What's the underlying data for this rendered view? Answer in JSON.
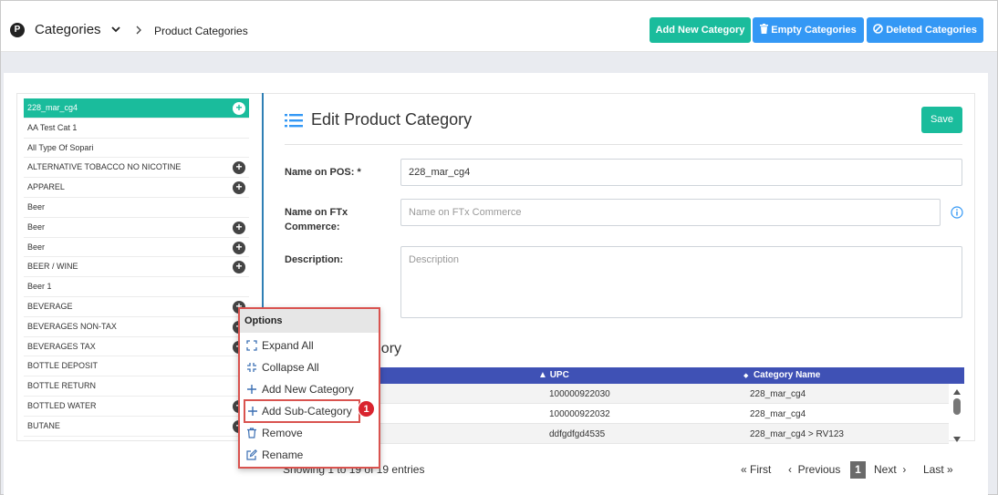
{
  "header": {
    "logo_letter": "P",
    "section": "Categories",
    "page": "Product Categories",
    "buttons": {
      "add_new": "Add New Category",
      "empty": "Empty Categories",
      "deleted": "Deleted Categories"
    }
  },
  "tree": {
    "items": [
      {
        "label": "228_mar_cg4",
        "active": true,
        "has_plus": true
      },
      {
        "label": "AA Test Cat 1",
        "has_plus": false
      },
      {
        "label": "All Type Of Sopari",
        "has_plus": false
      },
      {
        "label": "ALTERNATIVE TOBACCO NO NICOTINE",
        "has_plus": true
      },
      {
        "label": "APPAREL",
        "has_plus": true
      },
      {
        "label": "Beer",
        "has_plus": false
      },
      {
        "label": "Beer",
        "has_plus": true
      },
      {
        "label": "Beer",
        "has_plus": true
      },
      {
        "label": "BEER / WINE",
        "has_plus": true
      },
      {
        "label": "Beer 1",
        "has_plus": false
      },
      {
        "label": "BEVERAGE",
        "has_plus": true
      },
      {
        "label": "BEVERAGES NON-TAX",
        "has_plus": true
      },
      {
        "label": "BEVERAGES TAX",
        "has_plus": true
      },
      {
        "label": "BOTTLE DEPOSIT",
        "has_plus": false
      },
      {
        "label": "BOTTLE RETURN",
        "has_plus": false
      },
      {
        "label": "BOTTLED WATER",
        "has_plus": true
      },
      {
        "label": "BUTANE",
        "has_plus": true
      }
    ]
  },
  "form": {
    "title": "Edit Product Category",
    "save_label": "Save",
    "name_pos_label": "Name on POS: *",
    "name_pos_value": "228_mar_cg4",
    "name_ftx_label_1": "Name on FTx",
    "name_ftx_label_2": "Commerce:",
    "name_ftx_placeholder": "Name on FTx Commerce",
    "description_label": "Description:",
    "description_placeholder": "Description"
  },
  "products": {
    "title_fragment": "egory",
    "columns": {
      "upc": "UPC",
      "category_name": "Category Name"
    },
    "rows": [
      {
        "upc": "100000922030",
        "category": "228_mar_cg4"
      },
      {
        "upc": "100000922032",
        "category": "228_mar_cg4"
      },
      {
        "upc": "ddfgdfgd4535",
        "category": "228_mar_cg4 > RV123"
      }
    ],
    "showing": "Showing 1 to 19 of 19 entries",
    "pager": {
      "first": "First",
      "previous": "Previous",
      "current": "1",
      "next": "Next",
      "last": "Last"
    }
  },
  "context_menu": {
    "header": "Options",
    "items": [
      {
        "label": "Expand All",
        "icon": "expand-icon"
      },
      {
        "label": "Collapse All",
        "icon": "collapse-icon"
      },
      {
        "label": "Add New Category",
        "icon": "plus-icon"
      },
      {
        "label": "Add Sub-Category",
        "icon": "plus-icon"
      },
      {
        "label": "Remove",
        "icon": "trash-icon"
      },
      {
        "label": "Rename",
        "icon": "edit-icon"
      }
    ],
    "step_badge": "1"
  },
  "colors": {
    "teal": "#1abc9c",
    "blue": "#3498f5",
    "table_header": "#3f51b5",
    "highlight": "#d9534f"
  }
}
